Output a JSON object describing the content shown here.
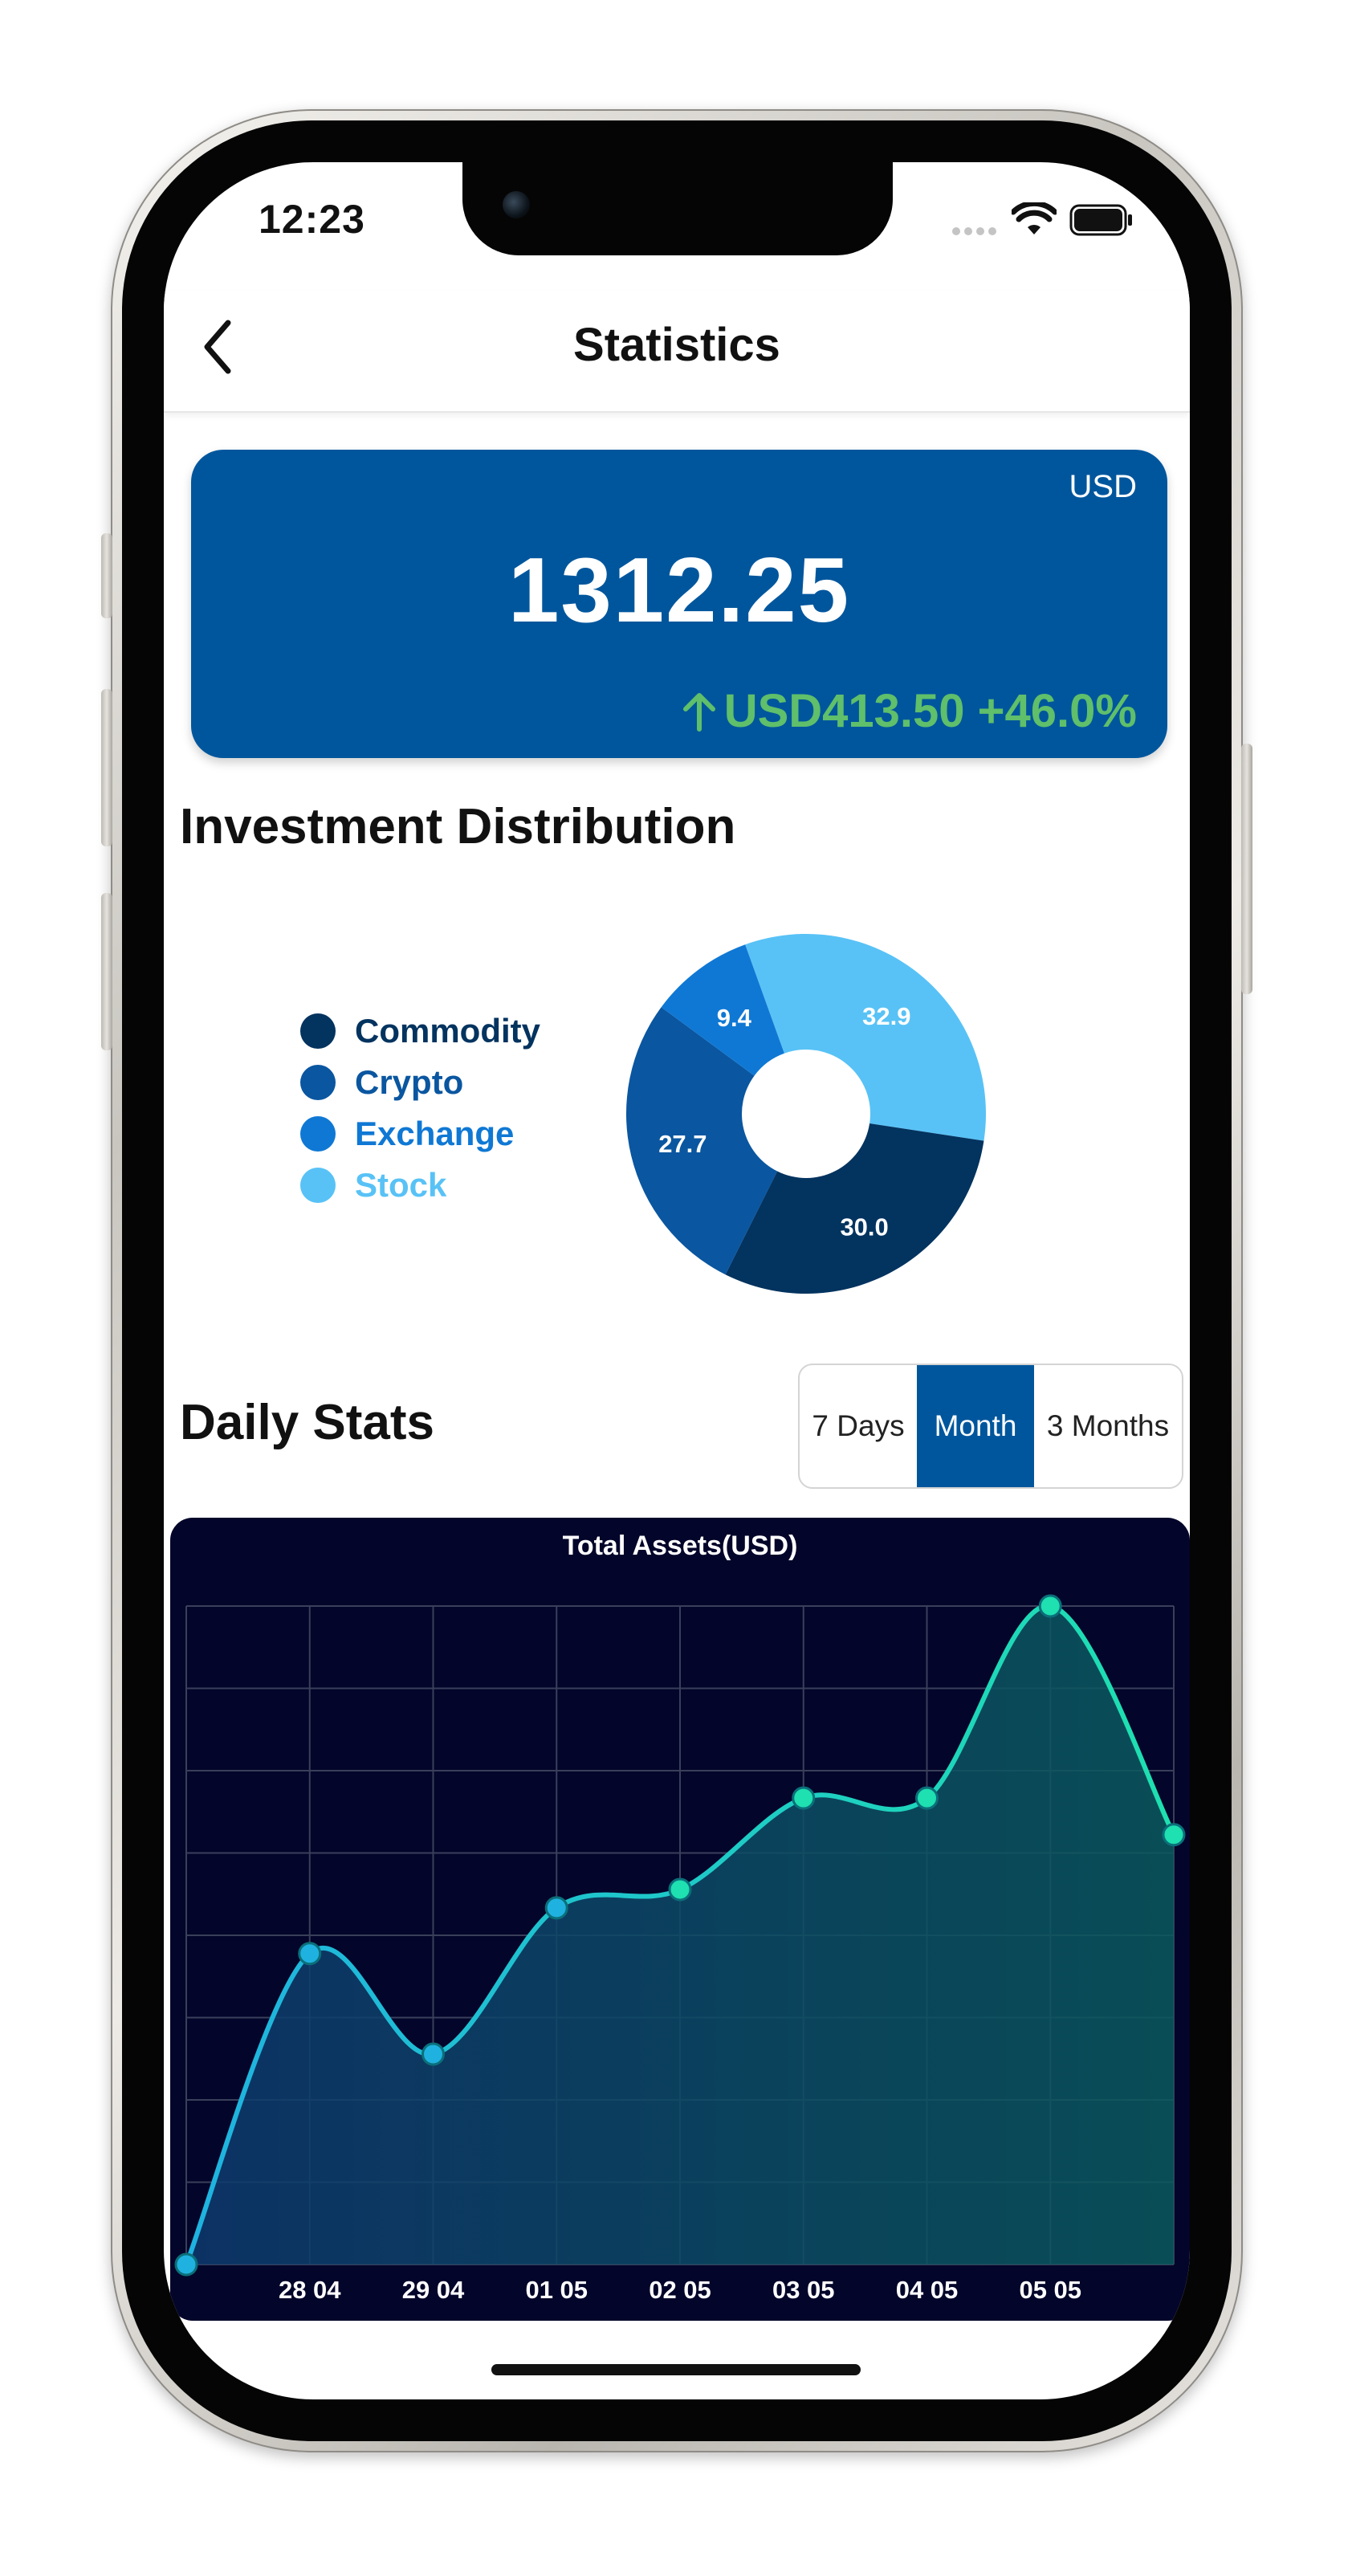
{
  "status_bar": {
    "time": "12:23"
  },
  "nav": {
    "title": "Statistics"
  },
  "balance": {
    "currency": "USD",
    "amount": "1312.25",
    "change_text": "USD413.50 +46.0%"
  },
  "distribution": {
    "title": "Investment Distribution",
    "legend": [
      {
        "label": "Commodity",
        "color": "#03335f"
      },
      {
        "label": "Crypto",
        "color": "#0a56a0"
      },
      {
        "label": "Exchange",
        "color": "#0f78d4"
      },
      {
        "label": "Stock",
        "color": "#58c2f6"
      }
    ]
  },
  "daily": {
    "title": "Daily Stats",
    "tabs": [
      {
        "label": "7 Days",
        "active": false
      },
      {
        "label": "Month",
        "active": true
      },
      {
        "label": "3 Months",
        "active": false
      }
    ]
  },
  "chart_data": [
    {
      "type": "pie",
      "donut": true,
      "categories": [
        "Stock",
        "Commodity",
        "Crypto",
        "Exchange"
      ],
      "values": [
        32.9,
        30.0,
        27.7,
        9.4
      ],
      "colors": [
        "#58c2f6",
        "#03335f",
        "#0a56a0",
        "#0f78d4"
      ],
      "data_labels": [
        "32.9",
        "30.0",
        "27.7",
        "9.4"
      ],
      "legend_position": "left"
    },
    {
      "type": "area",
      "title": "Total Assets(USD)",
      "x_tick_labels": [
        "28 04",
        "29 04",
        "01 05",
        "02 05",
        "03 05",
        "04 05",
        "05 05"
      ],
      "values": [
        0,
        3.4,
        2.3,
        3.9,
        4.1,
        5.1,
        5.1,
        7.2,
        4.7
      ],
      "ylim": [
        0,
        7.2
      ],
      "grid": true,
      "line_colors": [
        "#1fb2e0",
        "#1ee0b0"
      ],
      "background": "#03052a"
    }
  ]
}
